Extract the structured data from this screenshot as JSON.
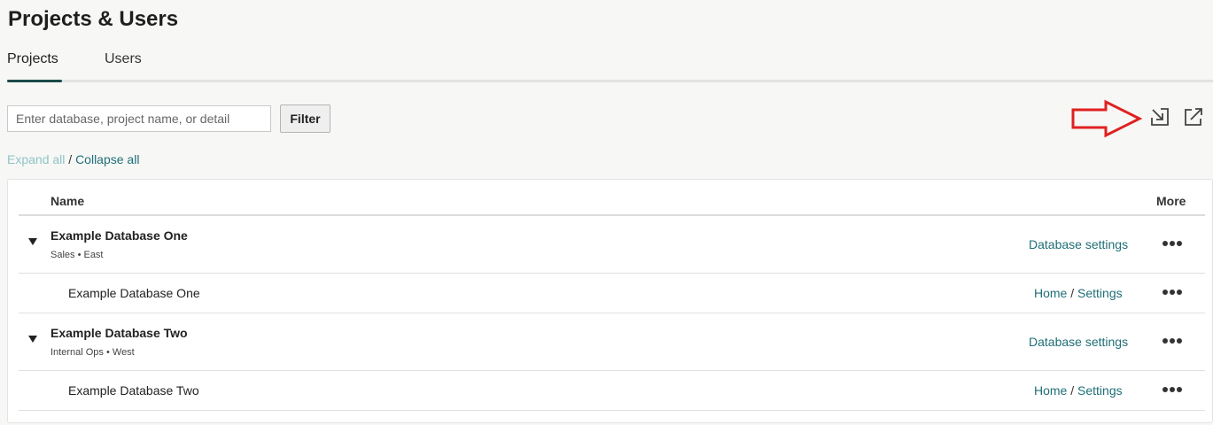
{
  "page": {
    "title": "Projects & Users"
  },
  "tabs": [
    {
      "label": "Projects",
      "active": true
    },
    {
      "label": "Users",
      "active": false
    }
  ],
  "filter": {
    "placeholder": "Enter database, project name, or detail",
    "value": "",
    "button_label": "Filter"
  },
  "expand_controls": {
    "expand_label": "Expand all",
    "separator": "/",
    "collapse_label": "Collapse all"
  },
  "toolbar_icons": [
    "import-arrow-icon",
    "external-link-icon"
  ],
  "annotation": {
    "shape": "red-outline-arrow",
    "color": "#e02020"
  },
  "table": {
    "columns": {
      "name": "Name",
      "more": "More"
    },
    "databases": [
      {
        "name": "Example Database One",
        "meta": "Sales • East",
        "settings_label": "Database settings",
        "expanded": true,
        "projects": [
          {
            "name": "Example Database One",
            "home_label": "Home",
            "separator": "/",
            "settings_label": "Settings"
          }
        ]
      },
      {
        "name": "Example Database Two",
        "meta": "Internal Ops • West",
        "settings_label": "Database settings",
        "expanded": true,
        "projects": [
          {
            "name": "Example Database Two",
            "home_label": "Home",
            "separator": "/",
            "settings_label": "Settings"
          }
        ]
      }
    ]
  },
  "colors": {
    "accent": "#1b4a48",
    "link": "#1f6f77",
    "link_muted": "#8fc4c8",
    "background": "#f7f7f5"
  }
}
